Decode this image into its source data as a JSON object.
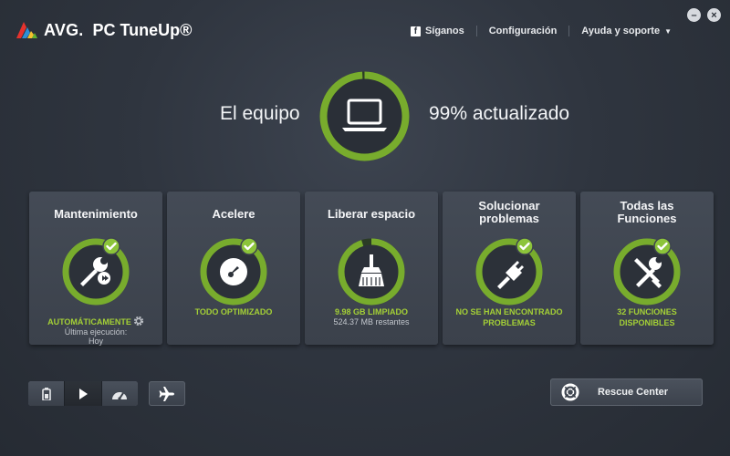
{
  "app": {
    "brand": "AVG.",
    "product": "PC TuneUp®",
    "colors": {
      "accent": "#a4d036",
      "ring": "#78ac2d",
      "background": "#2f353f",
      "card": "#424852"
    }
  },
  "topnav": {
    "follow": "Síganos",
    "settings": "Configuración",
    "help": "Ayuda y soporte"
  },
  "window": {
    "minimize": "–",
    "close": "×"
  },
  "status": {
    "left": "El equipo",
    "right": "99% actualizado",
    "progress": 0.99,
    "icon": "laptop-icon"
  },
  "cards": [
    {
      "title": "Mantenimiento",
      "status": "AUTOMÁTICAMENTE",
      "sub1": "Última ejecución:",
      "sub2": "Hoy",
      "icon": "wrench-icon",
      "checked": true
    },
    {
      "title": "Acelere",
      "status": "TODO OPTIMIZADO",
      "icon": "speedometer-icon",
      "checked": true
    },
    {
      "title": "Liberar espacio",
      "status": "9.98 GB LIMPIADO",
      "sub1": "524.37 MB restantes",
      "icon": "broom-icon",
      "checked": false,
      "progress": 0.95
    },
    {
      "title1": "Solucionar",
      "title2": "problemas",
      "status1": "NO SE HAN ENCONTRADO",
      "status2": "PROBLEMAS",
      "icon": "plug-icon",
      "checked": true
    },
    {
      "title1": "Todas las",
      "title2": "Funciones",
      "status1": "32 FUNCIONES",
      "status2": "DISPONIBLES",
      "icon": "tools-icon",
      "checked": true
    }
  ],
  "bottom": {
    "modes": [
      "battery-icon",
      "play-icon",
      "dashboard-icon"
    ],
    "active_mode": "play",
    "flight": "airplane-icon",
    "rescue_label": "Rescue Center"
  }
}
